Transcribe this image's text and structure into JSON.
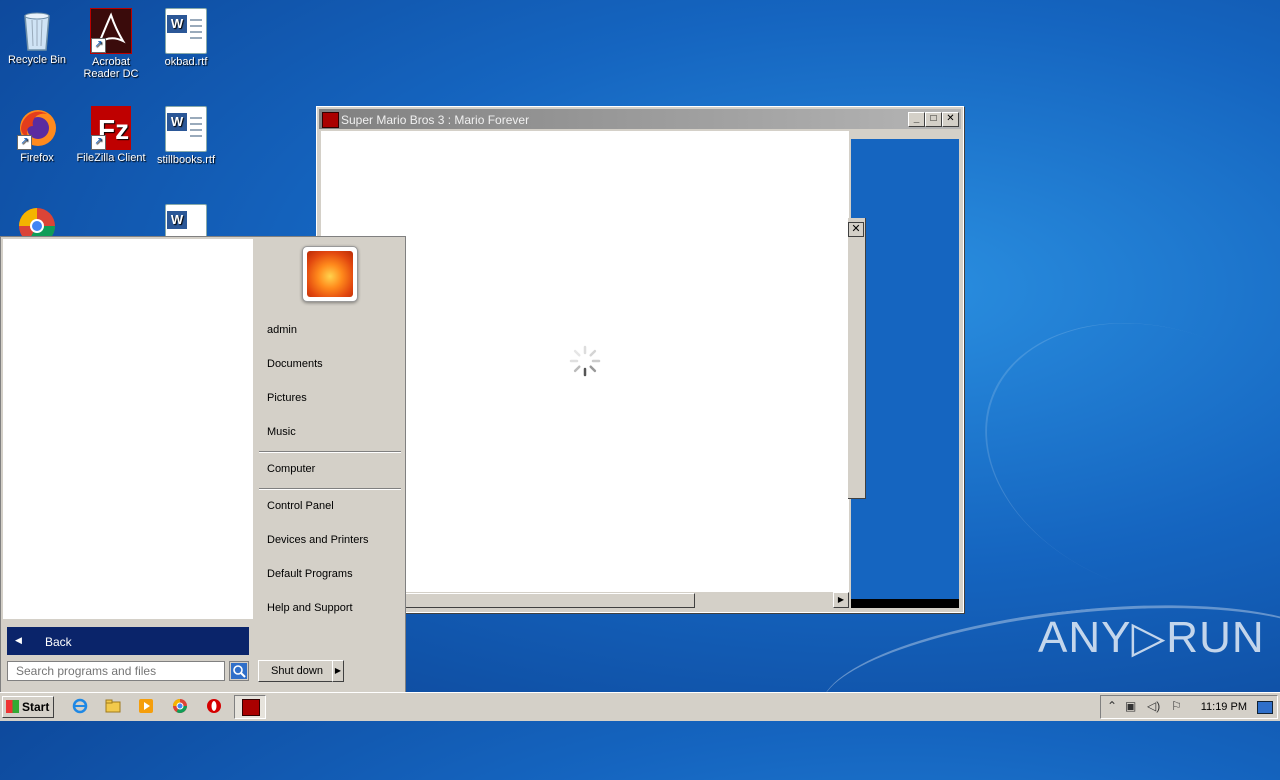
{
  "desktop": {
    "icons": [
      {
        "label": "Recycle Bin",
        "icon": "recycle-bin-icon"
      },
      {
        "label": "Acrobat Reader DC",
        "icon": "acrobat-icon"
      },
      {
        "label": "okbad.rtf",
        "icon": "word-document-icon"
      },
      {
        "label": "Firefox",
        "icon": "firefox-icon"
      },
      {
        "label": "FileZilla Client",
        "icon": "filezilla-icon"
      },
      {
        "label": "stillbooks.rtf",
        "icon": "word-document-icon"
      }
    ]
  },
  "window": {
    "title": "Super Mario Bros 3 : Mario Forever",
    "minimize": "_",
    "maximize": "□",
    "close": "✕",
    "dialog_close": "✕"
  },
  "start_menu": {
    "user": "admin",
    "links": [
      "Documents",
      "Pictures",
      "Music",
      "Computer",
      "Control Panel",
      "Devices and Printers",
      "Default Programs",
      "Help and Support"
    ],
    "back_label": "Back",
    "search_placeholder": "Search programs and files",
    "shutdown_label": "Shut down"
  },
  "taskbar": {
    "start_label": "Start",
    "clock": "11:19 PM",
    "pinned": [
      "internet-explorer-icon",
      "file-explorer-icon",
      "media-player-icon",
      "chrome-icon",
      "opera-icon",
      "mario-app-icon"
    ]
  },
  "watermark": "ANY▷RUN"
}
